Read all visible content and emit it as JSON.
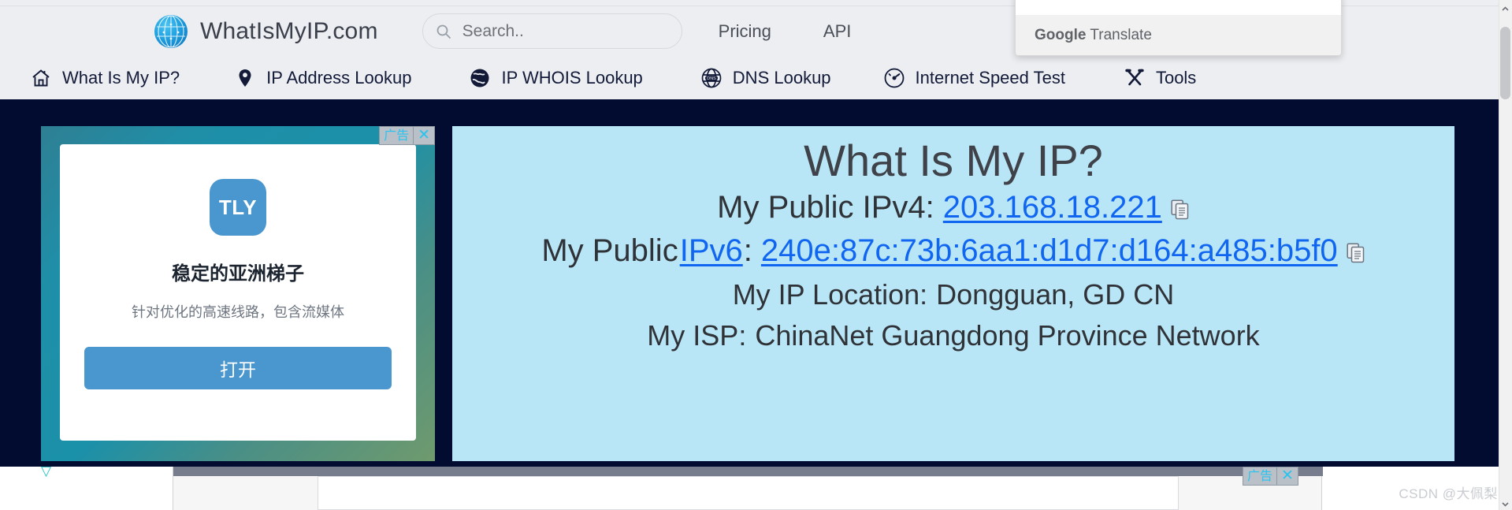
{
  "site": {
    "brand_name": "WhatIsMyIP.com",
    "logo_icon": "globe-network-icon"
  },
  "search": {
    "placeholder": "Search..",
    "value": "",
    "icon": "search-icon"
  },
  "top_nav": {
    "pricing": "Pricing",
    "api": "API"
  },
  "main_nav": [
    {
      "label": "What Is My IP?",
      "icon": "home-icon"
    },
    {
      "label": "IP Address Lookup",
      "icon": "map-pin-icon"
    },
    {
      "label": "IP WHOIS Lookup",
      "icon": "globe-icon"
    },
    {
      "label": "DNS Lookup",
      "icon": "dns-globe-icon"
    },
    {
      "label": "Internet Speed Test",
      "icon": "speedometer-icon"
    },
    {
      "label": "Tools",
      "icon": "tools-icon"
    }
  ],
  "translate_popup": {
    "title": "Google Translate",
    "title_bold": "Google",
    "title_rest": " Translate",
    "accent_color": "#1a73e8"
  },
  "ad_left": {
    "badge_label": "广告",
    "close_label": "✕",
    "logo_text": "TLY",
    "headline": "稳定的亚洲梯子",
    "subtext": "针对优化的高速线路，包含流媒体",
    "button_label": "打开",
    "corner_icon": "▽",
    "button_color": "#4a96cf"
  },
  "ip_panel": {
    "title": "What Is My IP?",
    "ipv4_label": "My Public IPv4:",
    "ipv4_value": "203.168.18.221",
    "ipv6_label_prefix": "My Public ",
    "ipv6_label_link": "IPv6",
    "ipv6_label_colon": ":",
    "ipv6_value": "240e:87c:73b:6aa1:d1d7:d164:a485:b5f0",
    "location_label": "My IP Location:",
    "location_value": "Dongguan, GD CN",
    "isp_label": "My ISP:",
    "isp_value": "ChinaNet Guangdong Province Network",
    "copy_icon": "copy-icon",
    "panel_color": "#b9e6f7",
    "link_color": "#1066f0"
  },
  "ad_bottom": {
    "badge_label": "广告",
    "close_label": "✕"
  },
  "watermark": {
    "text": "CSDN @大佩梨"
  }
}
